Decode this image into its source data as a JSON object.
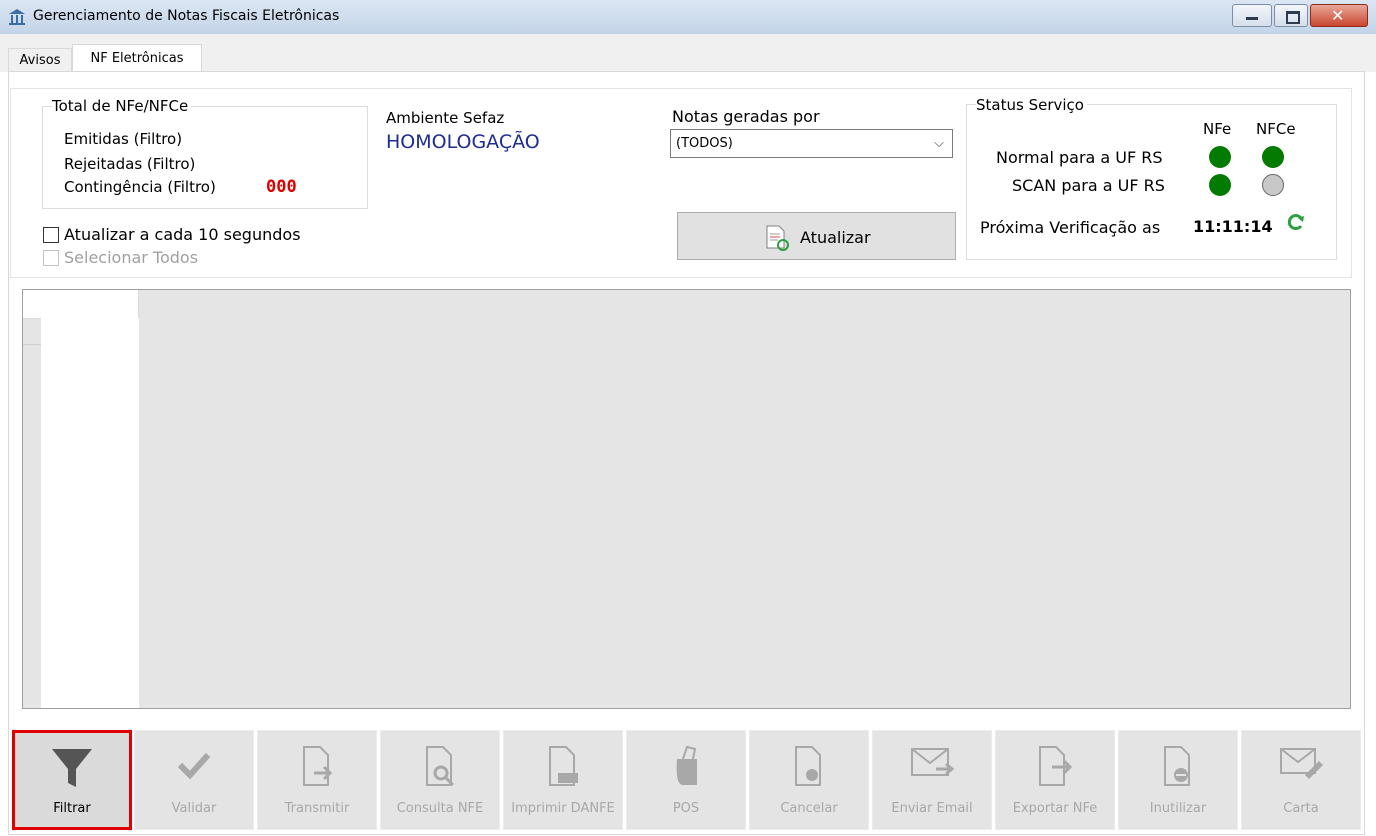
{
  "window": {
    "title": "Gerenciamento de Notas Fiscais Eletrônicas"
  },
  "tabs": [
    {
      "label": "Avisos"
    },
    {
      "label": "NF Eletrônicas"
    }
  ],
  "totals": {
    "legend": "Total de NFe/NFCe",
    "emitidas": "Emitidas (Filtro)",
    "rejeitadas": "Rejeitadas (Filtro)",
    "contingencia": "Contingência (Filtro)",
    "contingencia_value": "000"
  },
  "ambiente": {
    "label": "Ambiente Sefaz",
    "value": "HOMOLOGAÇÃO"
  },
  "notas": {
    "label": "Notas geradas por",
    "selected": "(TODOS)"
  },
  "options": {
    "atualizar_label": "Atualizar a cada 10 segundos",
    "selecionar_label": "Selecionar Todos"
  },
  "atualizar_button": "Atualizar",
  "status": {
    "legend": "Status Serviço",
    "col_nfe": "NFe",
    "col_nfce": "NFCe",
    "normal_label": "Normal para a UF RS",
    "scan_label": "SCAN para a UF RS",
    "proxima_label": "Próxima Verificação as",
    "proxima_time": "11:11:14",
    "colors": {
      "green": "#037a00",
      "gray": "#c8c8c8"
    }
  },
  "toolbar": [
    {
      "label": "Filtrar",
      "icon": "funnel-icon"
    },
    {
      "label": "Validar",
      "icon": "checkmark-icon"
    },
    {
      "label": "Transmitir",
      "icon": "document-arrow-icon"
    },
    {
      "label": "Consulta NFE",
      "icon": "document-search-icon"
    },
    {
      "label": "Imprimir DANFE",
      "icon": "document-print-icon"
    },
    {
      "label": "POS",
      "icon": "pos-printer-icon"
    },
    {
      "label": "Cancelar",
      "icon": "document-cancel-icon"
    },
    {
      "label": "Enviar Email",
      "icon": "email-send-icon"
    },
    {
      "label": "Exportar NFe",
      "icon": "document-export-icon"
    },
    {
      "label": "Inutilizar",
      "icon": "document-disable-icon"
    },
    {
      "label": "Carta",
      "icon": "envelope-pen-icon"
    }
  ]
}
